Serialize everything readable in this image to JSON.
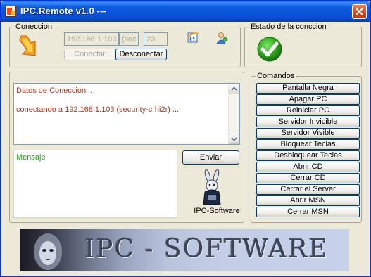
{
  "window": {
    "title": "IPC.Remote v1.0  ---"
  },
  "conexion": {
    "legend": "Coneccion",
    "ip_value": "192.168.1.103",
    "extra_value": "(sec",
    "port_value": "23",
    "connect_label": "Conectar",
    "disconnect_label": "Desconectar"
  },
  "estado": {
    "legend": "Estado de la conccion"
  },
  "log": {
    "lines": [
      "Datos de Coneccion...",
      "conectando a 192.168.1.103   (security-crhi2r)  ..."
    ],
    "color": "#b2361a"
  },
  "mensaje": {
    "placeholder_text": "Mensaje",
    "send_label": "Enviar",
    "color": "#2a9d17"
  },
  "brand": {
    "label": "IPC-Software",
    "banner_text": "IPC - SOFTWARE"
  },
  "comandos": {
    "legend": "Comandos",
    "buttons": [
      "Pantalla Negra",
      "Apagar PC",
      "Reiniciar PC",
      "Servidor Invicible",
      "Servidor Visible",
      "Bloquear Teclas",
      "Desbloquear Teclas",
      "Abrir CD",
      "Cerrar CD",
      "Cerrar el Server",
      "Abrir MSN",
      "Cerrar MSN"
    ]
  },
  "icons": {
    "app": "app-icon",
    "close": "close-icon",
    "connect_arrow": "lightning-arrow-icon",
    "ie": "internet-explorer-icon",
    "user": "user-icon",
    "status_ok": "green-check-icon",
    "mascot": "rabbit-mascot-icon"
  }
}
